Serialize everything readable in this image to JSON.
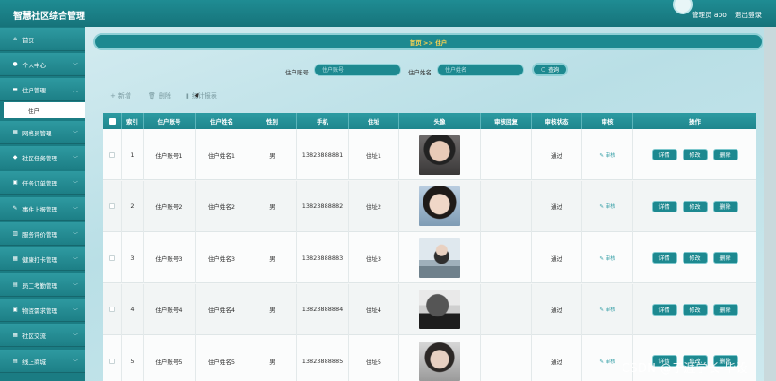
{
  "header": {
    "title": "智慧社区综合管理",
    "admin": "管理员 abo",
    "logout": "退出登录"
  },
  "sidebar": {
    "items": [
      {
        "label": "首页",
        "icon": "home-icon",
        "glyph": "⌂"
      },
      {
        "label": "个人中心",
        "icon": "user-icon",
        "glyph": "●"
      },
      {
        "label": "住户管理",
        "icon": "card-icon",
        "glyph": "▬"
      },
      {
        "label": "网格员管理",
        "icon": "grid-icon",
        "glyph": "▦"
      },
      {
        "label": "社区任务管理",
        "icon": "task-icon",
        "glyph": "◆"
      },
      {
        "label": "任务订单管理",
        "icon": "order-icon",
        "glyph": "▣"
      },
      {
        "label": "事件上报管理",
        "icon": "report-icon",
        "glyph": "✎"
      },
      {
        "label": "服务评价管理",
        "icon": "rating-icon",
        "glyph": "▥"
      },
      {
        "label": "健康打卡管理",
        "icon": "health-icon",
        "glyph": "▦"
      },
      {
        "label": "员工考勤管理",
        "icon": "attendance-icon",
        "glyph": "▤"
      },
      {
        "label": "物资需求管理",
        "icon": "supply-icon",
        "glyph": "▣"
      },
      {
        "label": "社区交流",
        "icon": "chat-icon",
        "glyph": "▦"
      },
      {
        "label": "线上商城",
        "icon": "shop-icon",
        "glyph": "▤"
      }
    ],
    "sub_item": "住户"
  },
  "breadcrumb": "首页 >> 住户",
  "search": {
    "account_label": "住户账号",
    "account_placeholder": "住户账号",
    "name_label": "住户姓名",
    "name_placeholder": "住户姓名",
    "query_label": "查询"
  },
  "actions": {
    "add": "新增",
    "delete": "删除",
    "stats": "统计报表"
  },
  "table": {
    "columns": [
      "索引",
      "住户账号",
      "住户姓名",
      "性别",
      "手机",
      "住址",
      "头像",
      "审核回复",
      "审核状态",
      "审核",
      "操作"
    ],
    "audit_link": "审核",
    "op_buttons": [
      "详情",
      "修改",
      "删除"
    ],
    "rows": [
      {
        "index": "1",
        "account": "住户账号1",
        "name": "住户姓名1",
        "gender": "男",
        "phone": "13823888881",
        "address": "住址1",
        "reply": "",
        "status": "通过"
      },
      {
        "index": "2",
        "account": "住户账号2",
        "name": "住户姓名2",
        "gender": "男",
        "phone": "13823888882",
        "address": "住址2",
        "reply": "",
        "status": "通过"
      },
      {
        "index": "3",
        "account": "住户账号3",
        "name": "住户姓名3",
        "gender": "男",
        "phone": "13823888883",
        "address": "住址3",
        "reply": "",
        "status": "通过"
      },
      {
        "index": "4",
        "account": "住户账号4",
        "name": "住户姓名4",
        "gender": "男",
        "phone": "13823888884",
        "address": "住址4",
        "reply": "",
        "status": "通过"
      },
      {
        "index": "5",
        "account": "住户账号5",
        "name": "住户姓名5",
        "gender": "男",
        "phone": "13823888885",
        "address": "住址5",
        "reply": "",
        "status": "通过"
      }
    ]
  },
  "watermark": "CSDN @于涯学长-毕设"
}
